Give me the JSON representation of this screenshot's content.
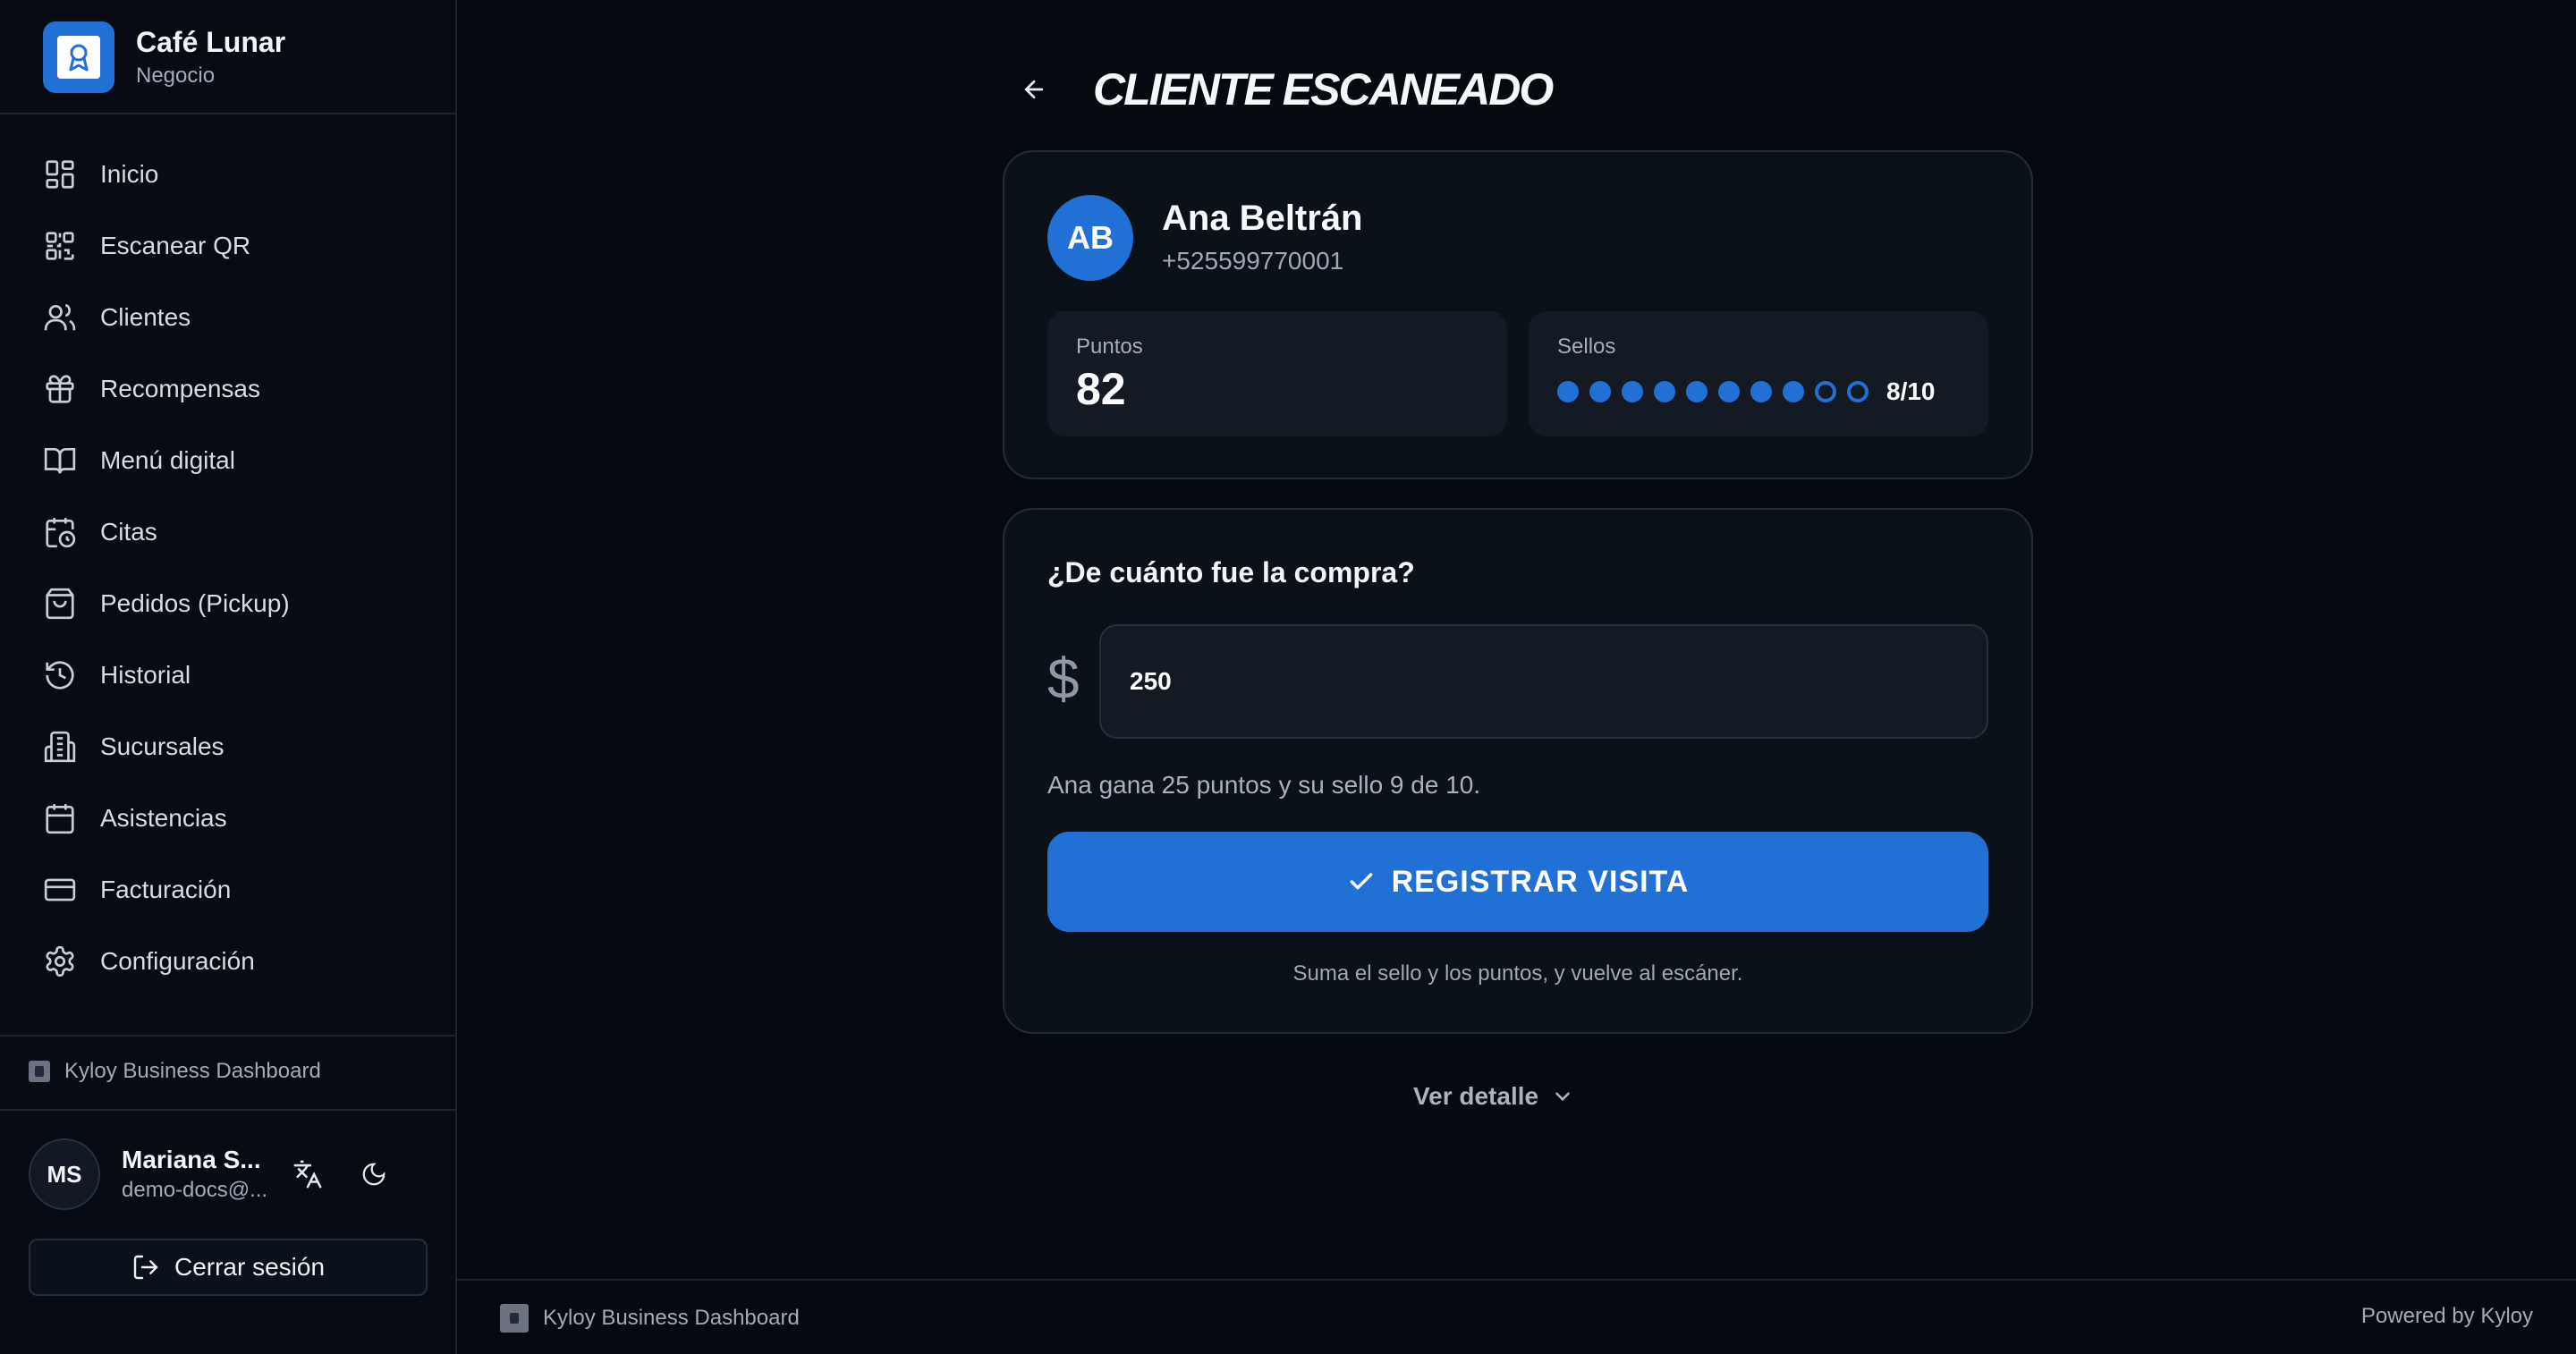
{
  "brand": {
    "name": "Café Lunar",
    "subtitle": "Negocio",
    "logo_icon": "award-ribbon-icon"
  },
  "sidebar": {
    "items": [
      {
        "label": "Inicio",
        "icon": "dashboard-grid-icon"
      },
      {
        "label": "Escanear QR",
        "icon": "qr-code-icon"
      },
      {
        "label": "Clientes",
        "icon": "users-icon"
      },
      {
        "label": "Recompensas",
        "icon": "gift-icon"
      },
      {
        "label": "Menú digital",
        "icon": "book-open-icon"
      },
      {
        "label": "Citas",
        "icon": "calendar-clock-icon"
      },
      {
        "label": "Pedidos (Pickup)",
        "icon": "shopping-bag-icon"
      },
      {
        "label": "Historial",
        "icon": "history-icon"
      },
      {
        "label": "Sucursales",
        "icon": "building-icon"
      },
      {
        "label": "Asistencias",
        "icon": "calendar-icon"
      },
      {
        "label": "Facturación",
        "icon": "credit-card-icon"
      },
      {
        "label": "Configuración",
        "icon": "gear-icon"
      }
    ],
    "footer_label": "Kyloy Business Dashboard",
    "user": {
      "initials": "MS",
      "name": "Mariana S...",
      "email": "demo-docs@..."
    },
    "logout_label": "Cerrar sesión"
  },
  "header": {
    "title": "CLIENTE ESCANEADO"
  },
  "client": {
    "initials": "AB",
    "name": "Ana Beltrán",
    "phone": "+525599770001",
    "points_label": "Puntos",
    "points": "82",
    "stamps_label": "Sellos",
    "stamps_filled": 8,
    "stamps_total": 10,
    "stamps_text": "8/10"
  },
  "purchase": {
    "question": "¿De cuánto fue la compra?",
    "currency": "$",
    "amount": "250",
    "gain_text": "Ana gana 25 puntos y su sello 9 de 10.",
    "register_label": "REGISTRAR VISITA",
    "hint": "Suma el sello y los puntos, y vuelve al escáner."
  },
  "detail_label": "Ver detalle",
  "footer": {
    "left": "Kyloy Business Dashboard",
    "right": "Powered by Kyloy"
  },
  "colors": {
    "accent": "#2170d6",
    "background": "#050910",
    "card": "#0b1119"
  }
}
